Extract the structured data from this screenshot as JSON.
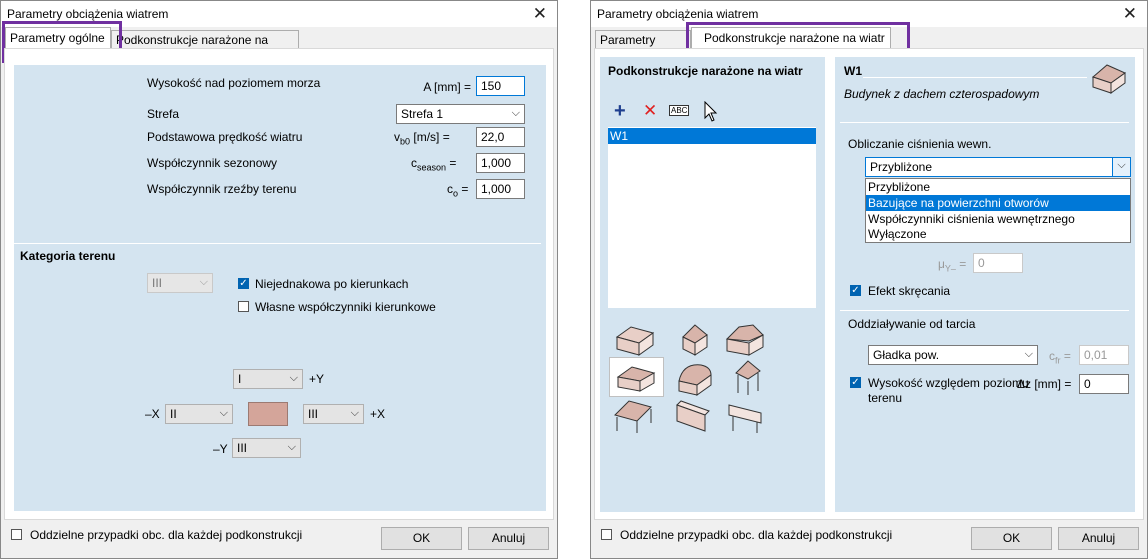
{
  "left": {
    "window_title": "Parametry obciążenia wiatrem",
    "tabs": [
      "Parametry ogólne",
      "Podkonstrukcje narażone na wiatr"
    ],
    "general": {
      "altitude_label": "Wysokość nad poziomem morza",
      "altitude_sym": "A [mm] =",
      "altitude_value": "150",
      "zone_label": "Strefa",
      "zone_value": "Strefa 1",
      "basic_speed_label": "Podstawowa prędkość wiatru",
      "basic_speed_sym_main": "v",
      "basic_speed_sym_sub": "b0",
      "basic_speed_sym_unit": "[m/s] =",
      "basic_speed_value": "22,0",
      "season_label": "Współczynnik sezonowy",
      "season_sym_main": "c",
      "season_sym_sub": "season",
      "season_sym_eq": "=",
      "season_value": "1,000",
      "orography_label": "Współczynnik rzeźby terenu",
      "orography_sym_main": "c",
      "orography_sym_sub": "o",
      "orography_sym_eq": "=",
      "orography_value": "1,000"
    },
    "terrain": {
      "heading": "Kategoria terenu",
      "category_value": "III",
      "nonuniform_label": "Niejednakowa po kierunkach",
      "nonuniform_checked": true,
      "custom_coeff_label": "Własne współczynniki kierunkowe",
      "custom_coeff_checked": false,
      "plus_y_value": "I",
      "plus_y_label": "+Y",
      "minus_x_label": "–X",
      "minus_x_value": "II",
      "plus_x_value": "III",
      "plus_x_label": "+X",
      "minus_y_label": "–Y",
      "minus_y_value": "III",
      "center_color": "#d4a59a"
    },
    "footer": {
      "separate_cases_label": "Oddzielne przypadki obc. dla każdej podkonstrukcji",
      "ok": "OK",
      "cancel": "Anuluj"
    }
  },
  "right": {
    "window_title": "Parametry obciążenia wiatrem",
    "tabs": [
      "Parametry ogólne",
      "Podkonstrukcje narażone na wiatr"
    ],
    "list_panel": {
      "heading": "Podkonstrukcje narażone na wiatr",
      "toolbar": [
        "add-icon",
        "delete-icon",
        "rename-icon"
      ],
      "rename_text": "ABC",
      "items": [
        "W1"
      ]
    },
    "detail": {
      "name": "W1",
      "description": "Budynek z dachem czterospadowym",
      "internal_pressure_label": "Obliczanie ciśnienia wewn.",
      "internal_pressure_value": "Przybliżone",
      "internal_pressure_options": [
        "Przybliżone",
        "Bazujące na powierzchni otworów",
        "Współczynniki ciśnienia wewnętrznego",
        "Wyłączone"
      ],
      "selected_option_index": 1,
      "mu_sym": "μ",
      "mu_sub": "Y–",
      "mu_eq": "=",
      "mu_value": "0",
      "torsion_label": "Efekt skręcania",
      "torsion_checked": true,
      "friction_heading": "Oddziaływanie od tarcia",
      "friction_value": "Gładka pow.",
      "cfr_sym": "c",
      "cfr_sub": "fr",
      "cfr_eq": "=",
      "cfr_value": "0,01",
      "height_label_1": "Wysokość względem poziomu",
      "height_label_2": "terenu",
      "height_sym": "Δz [mm] =",
      "height_checked": true,
      "height_value": "0"
    },
    "footer": {
      "separate_cases_label": "Oddzielne przypadki obc. dla każdej podkonstrukcji",
      "ok": "OK",
      "cancel": "Anuluj"
    }
  },
  "colors": {
    "panel": "#d4e4f0",
    "selection": "#0078d7",
    "highlight": "#7030a0"
  }
}
